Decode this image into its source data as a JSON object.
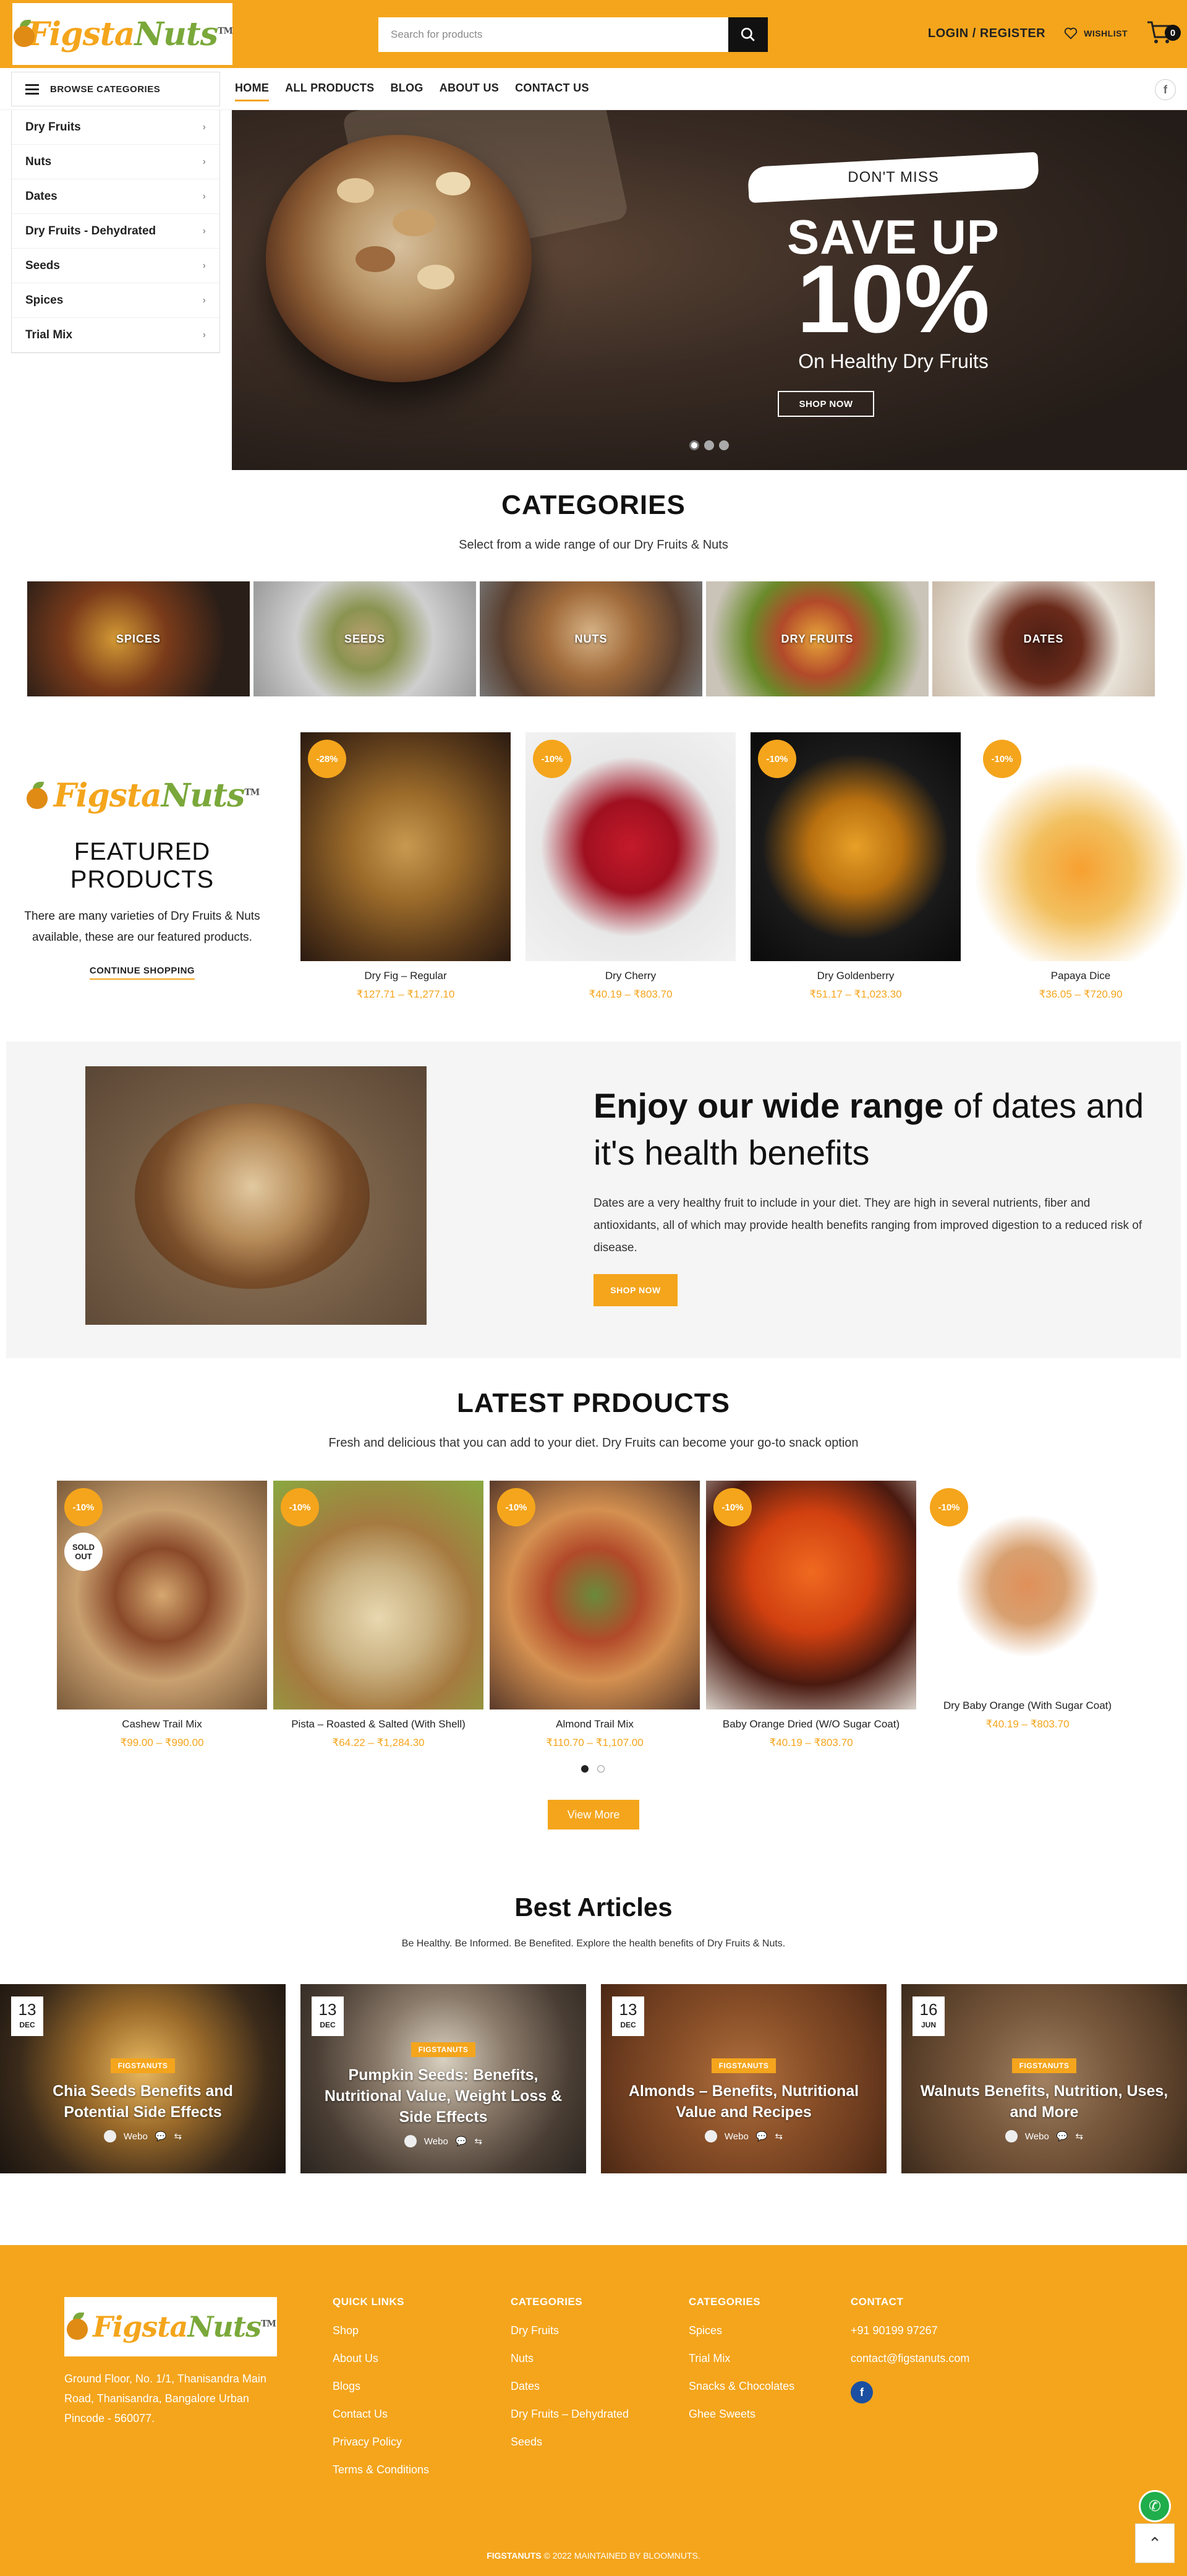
{
  "header": {
    "logo_a": "Figsta",
    "logo_b": "Nuts",
    "logo_tm": "TM",
    "search_placeholder": "Search for products",
    "login": "LOGIN / REGISTER",
    "wishlist": "WISHLIST",
    "cart_count": "0"
  },
  "nav": {
    "browse": "BROWSE CATEGORIES",
    "items": [
      "HOME",
      "ALL PRODUCTS",
      "BLOG",
      "ABOUT US",
      "CONTACT US"
    ],
    "social": "f"
  },
  "sidebar": {
    "items": [
      "Dry Fruits",
      "Nuts",
      "Dates",
      "Dry Fruits - Dehydrated",
      "Seeds",
      "Spices",
      "Trial Mix"
    ]
  },
  "hero": {
    "dont_miss": "DON'T MISS",
    "save_up": "SAVE UP",
    "percent": "10%",
    "subtitle": "On Healthy Dry Fruits",
    "shop_now": "SHOP NOW",
    "slides": 3,
    "active_slide": 1
  },
  "categories": {
    "title": "CATEGORIES",
    "subtitle": "Select from a wide range of our Dry Fruits & Nuts",
    "tiles": [
      "SPICES",
      "SEEDS",
      "NUTS",
      "DRY FRUITS",
      "DATES"
    ]
  },
  "featured": {
    "title": "FEATURED PRODUCTS",
    "description": "There are many varieties of Dry Fruits & Nuts available, these are our featured products.",
    "cta": "CONTINUE SHOPPING",
    "products": [
      {
        "badge": "-28%",
        "name": "Dry Fig – Regular",
        "price": "₹127.71 – ₹1,277.10"
      },
      {
        "badge": "-10%",
        "name": "Dry Cherry",
        "price": "₹40.19 – ₹803.70"
      },
      {
        "badge": "-10%",
        "name": "Dry Goldenberry",
        "price": "₹51.17 – ₹1,023.30"
      },
      {
        "badge": "-10%",
        "name": "Papaya Dice",
        "price": "₹36.05 – ₹720.90"
      }
    ]
  },
  "promo": {
    "title_bold": "Enjoy our wide range",
    "title_rest": " of dates and it's health benefits",
    "body": "Dates are a very healthy fruit to include in your diet. They are high in several nutrients, fiber and antioxidants, all of which may provide health benefits ranging from improved digestion to a reduced risk of disease.",
    "button": "SHOP NOW"
  },
  "latest": {
    "title": "LATEST PRDOUCTS",
    "subtitle": "Fresh and delicious that you can add to your diet. Dry Fruits can become your go-to snack option",
    "sold_out": "SOLD OUT",
    "products": [
      {
        "badge": "-10%",
        "name": "Cashew Trail Mix",
        "price": "₹99.00 – ₹990.00"
      },
      {
        "badge": "-10%",
        "name": "Pista – Roasted & Salted (With Shell)",
        "price": "₹64.22 – ₹1,284.30"
      },
      {
        "badge": "-10%",
        "name": "Almond Trail Mix",
        "price": "₹110.70 – ₹1,107.00"
      },
      {
        "badge": "-10%",
        "name": "Baby Orange Dried (W/O Sugar Coat)",
        "price": "₹40.19 – ₹803.70"
      },
      {
        "badge": "-10%",
        "name": "Dry Baby Orange (With Sugar Coat)",
        "price": "₹40.19 – ₹803.70"
      }
    ],
    "view_more": "View More"
  },
  "articles": {
    "title": "Best Articles",
    "subtitle": "Be Healthy. Be Informed. Be Benefited. Explore the health benefits of Dry Fruits & Nuts.",
    "items": [
      {
        "day": "13",
        "month": "DEC",
        "tag": "FIGSTANUTS",
        "title": "Chia Seeds Benefits and Potential Side Effects",
        "author": "Webo"
      },
      {
        "day": "13",
        "month": "DEC",
        "tag": "FIGSTANUTS",
        "title": "Pumpkin Seeds: Benefits, Nutritional Value, Weight Loss & Side Effects",
        "author": "Webo"
      },
      {
        "day": "13",
        "month": "DEC",
        "tag": "FIGSTANUTS",
        "title": "Almonds – Benefits, Nutritional Value and Recipes",
        "author": "Webo"
      },
      {
        "day": "16",
        "month": "JUN",
        "tag": "FIGSTANUTS",
        "title": "Walnuts Benefits, Nutrition, Uses, and More",
        "author": "Webo"
      }
    ]
  },
  "footer": {
    "address": "Ground Floor, No. 1/1, Thanisandra Main Road, Thanisandra, Bangalore Urban Pincode - 560077.",
    "quick_links_title": "QUICK LINKS",
    "quick_links": [
      "Shop",
      "About Us",
      "Blogs",
      "Contact Us",
      "Privacy Policy",
      "Terms & Conditions"
    ],
    "cat1_title": "CATEGORIES",
    "cat1": [
      "Dry Fruits",
      "Nuts",
      "Dates",
      "Dry Fruits – Dehydrated",
      "Seeds"
    ],
    "cat2_title": "CATEGORIES",
    "cat2": [
      "Spices",
      "Trial Mix",
      "Snacks & Chocolates",
      "Ghee Sweets"
    ],
    "contact_title": "CONTACT",
    "phone": "+91 90199 97267",
    "email": "contact@figstanuts.com",
    "copyright_brand": "FIGSTANUTS",
    "copyright_rest": " © 2022 MAINTAINED BY BLOOMNUTS."
  }
}
